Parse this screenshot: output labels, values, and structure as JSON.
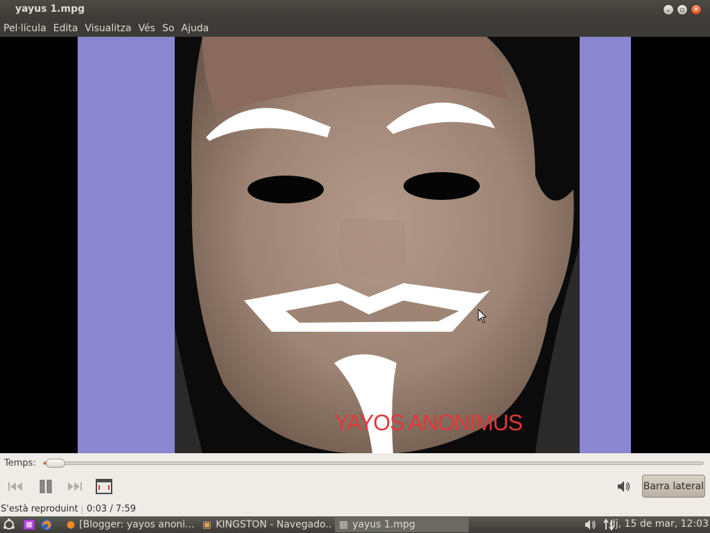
{
  "window": {
    "title": "yayus 1.mpg"
  },
  "menu": [
    "Pel·lícula",
    "Edita",
    "Visualitza",
    "Vés",
    "So",
    "Ajuda"
  ],
  "video": {
    "caption": "YAYOS ANONIMUS"
  },
  "controls": {
    "seek_label": "Temps:",
    "progress_fraction": 0.006,
    "sidebar_label": "Barra lateral"
  },
  "status": {
    "state": "S'està reproduint",
    "time": "0:03 / 7:59"
  },
  "taskbar": {
    "tasks": [
      "[Blogger: yayos anoni...",
      "KINGSTON - Navegado...",
      "yayus 1.mpg"
    ],
    "clock": "dj, 15 de mar, 12:03"
  },
  "colors": {
    "accent": "#e25a2a",
    "video_frame": "#8a86cf",
    "caption": "#e2373a"
  }
}
